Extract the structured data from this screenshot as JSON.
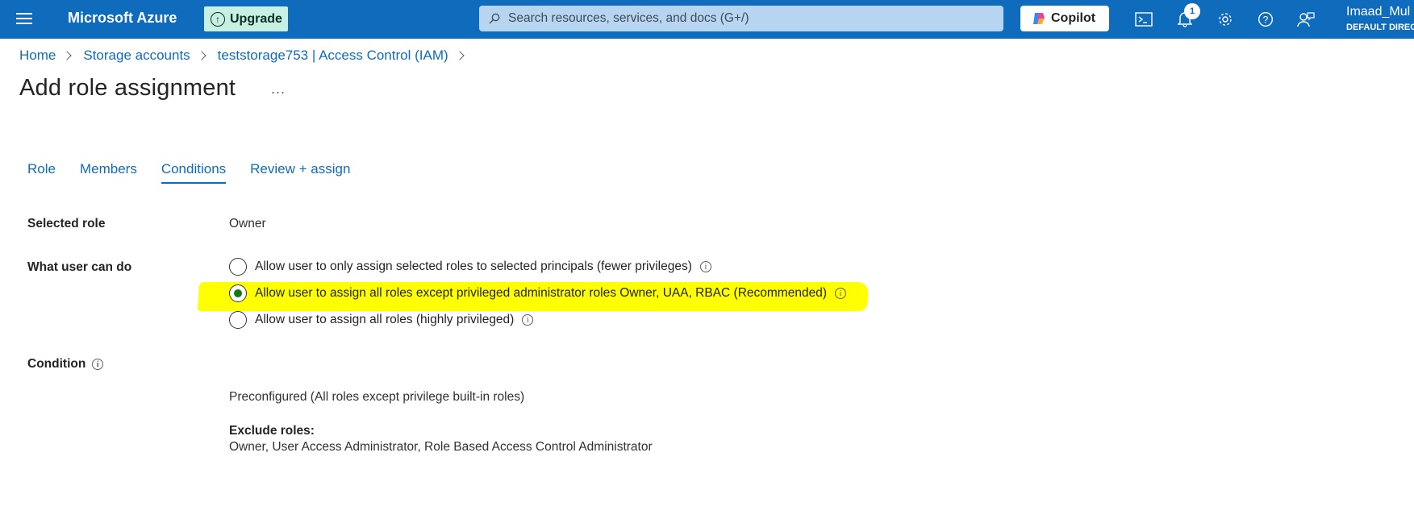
{
  "topbar": {
    "brand": "Microsoft Azure",
    "upgrade_label": "Upgrade",
    "search_placeholder": "Search resources, services, and docs (G+/)",
    "copilot_label": "Copilot",
    "notification_count": "1",
    "user_name": "Imaad_Mul",
    "user_directory": "DEFAULT DIREC",
    "bg_color": "#0f6cbd"
  },
  "breadcrumb": {
    "items": [
      "Home",
      "Storage accounts",
      "teststorage753 | Access Control (IAM)"
    ]
  },
  "page": {
    "title": "Add role assignment",
    "more_label": "..."
  },
  "tabs": [
    {
      "label": "Role",
      "active": false
    },
    {
      "label": "Members",
      "active": false
    },
    {
      "label": "Conditions",
      "active": true
    },
    {
      "label": "Review + assign",
      "active": false
    }
  ],
  "form": {
    "selected_role_label": "Selected role",
    "selected_role_value": "Owner",
    "what_user_can_do_label": "What user can do",
    "options": [
      {
        "label": "Allow user to only assign selected roles to selected principals (fewer privileges)",
        "checked": false
      },
      {
        "label": "Allow user to assign all roles except privileged administrator roles Owner, UAA, RBAC (Recommended)",
        "checked": true,
        "highlighted": true
      },
      {
        "label": "Allow user to assign all roles (highly privileged)",
        "checked": false
      }
    ],
    "condition_label": "Condition",
    "condition_value": "Preconfigured (All roles except privilege built-in roles)",
    "exclude_roles_label": "Exclude roles:",
    "exclude_roles_value": "Owner, User Access Administrator, Role Based Access Control Administrator"
  }
}
